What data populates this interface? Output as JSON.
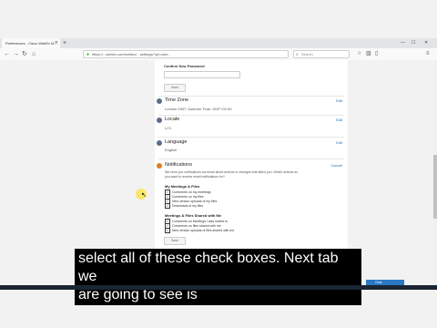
{
  "browser": {
    "tab_title": "Preferences - Cisco WebEx M...",
    "url": "https://...webex.com/webex/...settings/?pt=user...",
    "search_placeholder": "Search",
    "back_icon": "back-arrow-icon",
    "forward_icon": "forward-arrow-icon",
    "refresh_icon": "refresh-icon",
    "home_icon": "home-icon"
  },
  "password": {
    "confirm_label": "Confirm New Password",
    "save_label": "Save"
  },
  "timezone": {
    "title": "Time Zone",
    "value": "London GMT, Summer Time, GMT+01:00",
    "edit": "Edit"
  },
  "locale": {
    "title": "Locale",
    "value": "U.S.",
    "edit": "Edit"
  },
  "language": {
    "title": "Language",
    "value": "English",
    "edit": "Edit"
  },
  "notifications": {
    "title": "Notifications",
    "cancel": "Cancel",
    "description": "We send you notifications via email about actions or changes that affect you. Which actions do you want to receive email notifications for?",
    "group1_title": "My Meetings & Files",
    "group1_items": [
      "Comments on my meetings",
      "Comments on my files",
      "New version uploads of my files",
      "Downloads of my files"
    ],
    "group2_title": "Meetings & Files Shared with Me",
    "group2_items": [
      "Comments on Meetings I was invited to",
      "Comments on files shared with me",
      "New version uploads of files shared with me"
    ],
    "save_label": "Save"
  },
  "caption": {
    "line1": "select all of these check boxes. Next tab we",
    "line2": "are going to see is"
  },
  "toast": "Chat"
}
